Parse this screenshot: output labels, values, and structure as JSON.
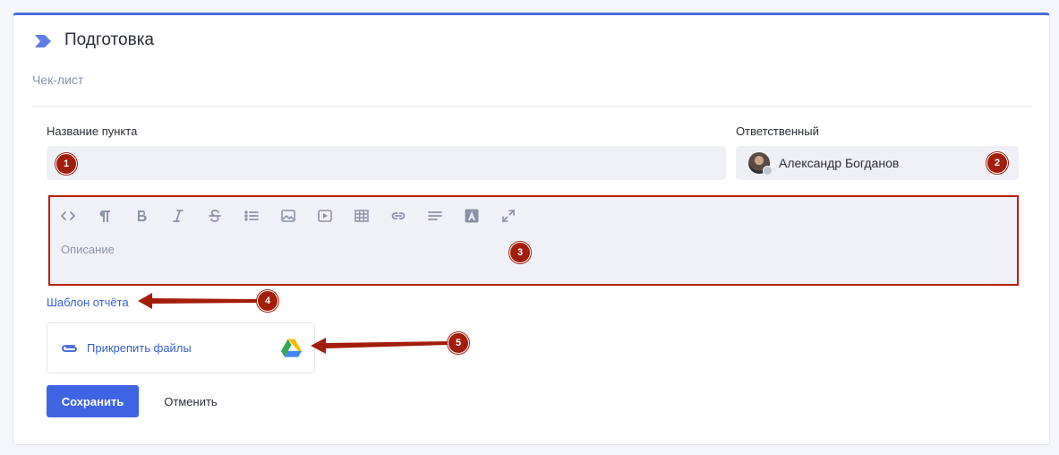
{
  "stage": {
    "title": "Подготовка",
    "subtitle": "Чек-лист"
  },
  "form": {
    "item_name_label": "Название пункта",
    "item_name_value": "",
    "assignee_label": "Ответственный",
    "assignee_name": "Александр Богданов",
    "description_placeholder": "Описание",
    "toolbar": [
      "code-icon",
      "paragraph-icon",
      "bold-icon",
      "italic-icon",
      "strikethrough-icon",
      "list-icon",
      "image-icon",
      "video-icon",
      "table-icon",
      "link-icon",
      "align-icon",
      "text-color-icon",
      "fullscreen-icon"
    ],
    "report_template_link": "Шаблон отчёта",
    "attach_files_label": "Прикрепить файлы",
    "save_label": "Сохранить",
    "cancel_label": "Отменить"
  },
  "markers": [
    "1",
    "2",
    "3",
    "4",
    "5"
  ],
  "colors": {
    "accent": "#3e64e4",
    "marker": "#a31d0b",
    "input_bg": "#eff0f6"
  }
}
